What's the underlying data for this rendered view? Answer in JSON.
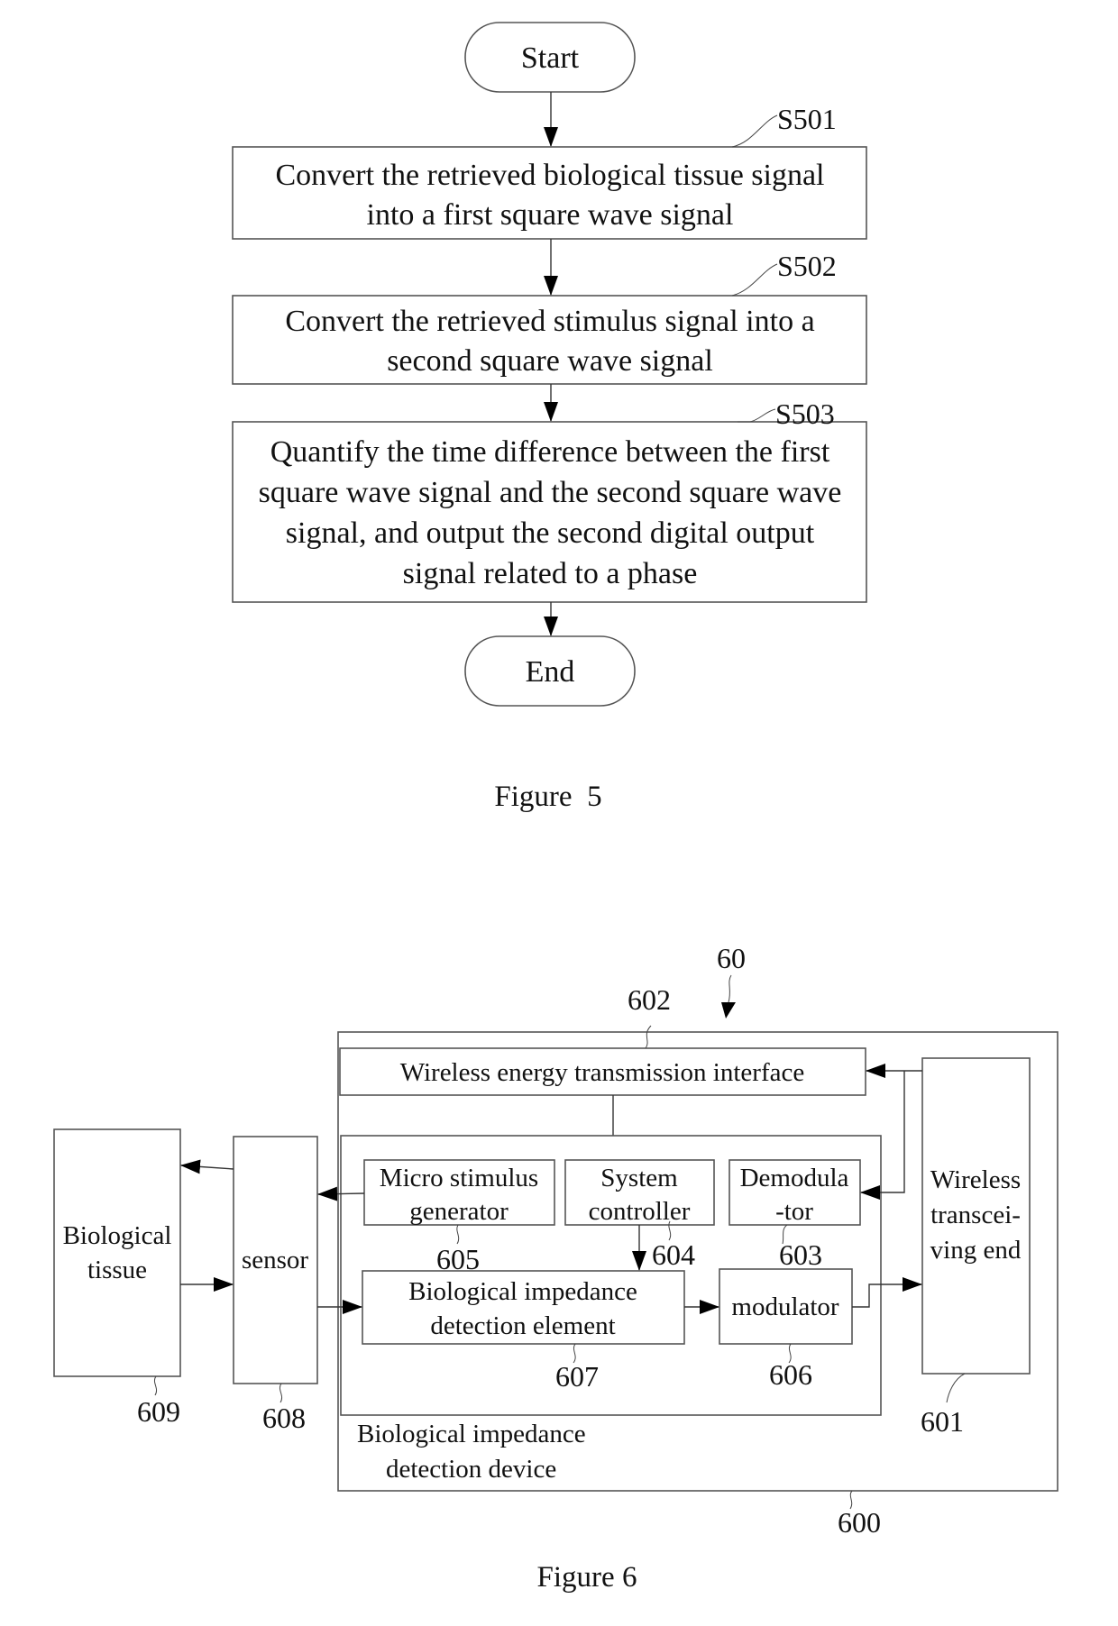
{
  "figure5": {
    "caption": "Figure  5",
    "start_label": "Start",
    "end_label": "End",
    "steps": [
      {
        "ref": "S501",
        "lines": [
          "Convert the retrieved biological tissue signal",
          "into a first square wave signal"
        ]
      },
      {
        "ref": "S502",
        "lines": [
          "Convert the retrieved stimulus signal into a",
          "second square wave signal"
        ]
      },
      {
        "ref": "S503",
        "lines": [
          "Quantify the time difference between the first",
          "square wave signal and the second square wave",
          "signal, and output the second digital output",
          "signal related to a phase"
        ]
      }
    ]
  },
  "figure6": {
    "caption": "Figure 6",
    "system_ref": "60",
    "device": {
      "ref": "600",
      "lines": [
        "Biological impedance",
        "detection device"
      ]
    },
    "inner_module_ref": "",
    "blocks": {
      "wireless_energy": {
        "ref": "602",
        "lines": [
          "Wireless energy transmission interface"
        ]
      },
      "wireless_transceiver": {
        "ref": "601",
        "lines": [
          "Wireless",
          "transcei-",
          "ving end"
        ]
      },
      "demodulator": {
        "ref": "603",
        "lines": [
          "Demodula",
          "-tor"
        ]
      },
      "system_controller": {
        "ref": "604",
        "lines": [
          "System",
          "controller"
        ]
      },
      "micro_stimulus": {
        "ref": "605",
        "lines": [
          "Micro stimulus",
          "generator"
        ]
      },
      "modulator": {
        "ref": "606",
        "lines": [
          "modulator"
        ]
      },
      "impedance_element": {
        "ref": "607",
        "lines": [
          "Biological impedance",
          "detection element"
        ]
      },
      "sensor": {
        "ref": "608",
        "lines": [
          "sensor"
        ]
      },
      "tissue": {
        "ref": "609",
        "lines": [
          "Biological",
          "tissue"
        ]
      }
    }
  }
}
